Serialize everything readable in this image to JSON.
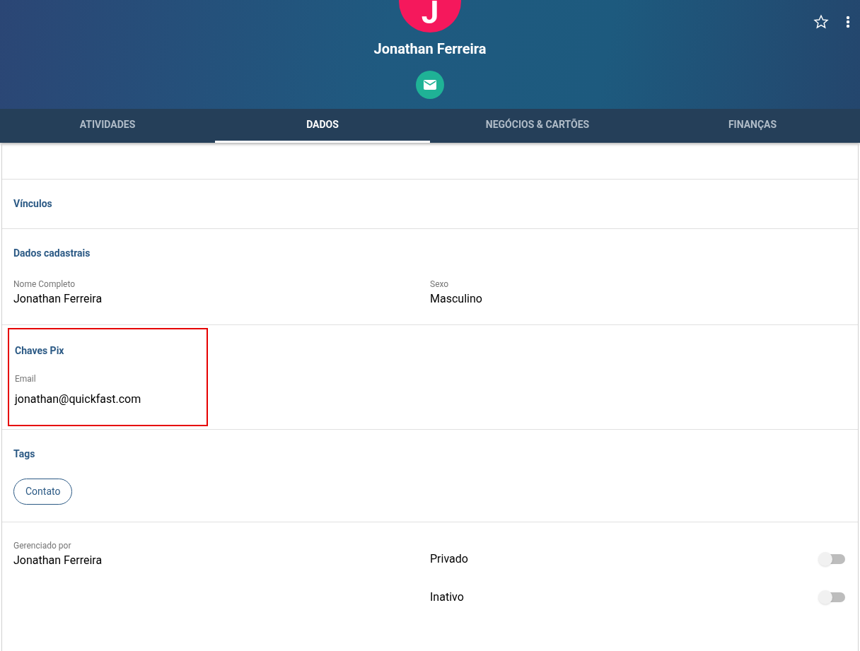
{
  "header": {
    "avatar_initial": "J",
    "name": "Jonathan Ferreira"
  },
  "tabs": [
    {
      "label": "ATIVIDADES",
      "selected": false
    },
    {
      "label": "DADOS",
      "selected": true
    },
    {
      "label": "NEGÓCIOS & CARTÕES",
      "selected": false
    },
    {
      "label": "FINANÇAS",
      "selected": false
    }
  ],
  "sections": [
    {
      "title": "Vínculos",
      "highlighted": false
    },
    {
      "title": "Dados cadastrais",
      "highlighted": false,
      "fields": [
        {
          "label": "Nome Completo",
          "value": "Jonathan Ferreira"
        },
        {
          "label": "Sexo",
          "value": "Masculino"
        }
      ]
    },
    {
      "title": "Chaves Pix",
      "highlighted": true,
      "fields": [
        {
          "label": "Email",
          "value": "jonathan@quickfast.com"
        }
      ]
    },
    {
      "title": "Tags",
      "highlighted": false,
      "tags": [
        "Contato"
      ]
    }
  ],
  "managed_by": {
    "label": "Gerenciado por",
    "value": "Jonathan Ferreira"
  },
  "toggles": [
    {
      "label": "Privado",
      "on": false
    },
    {
      "label": "Inativo",
      "on": false
    }
  ]
}
